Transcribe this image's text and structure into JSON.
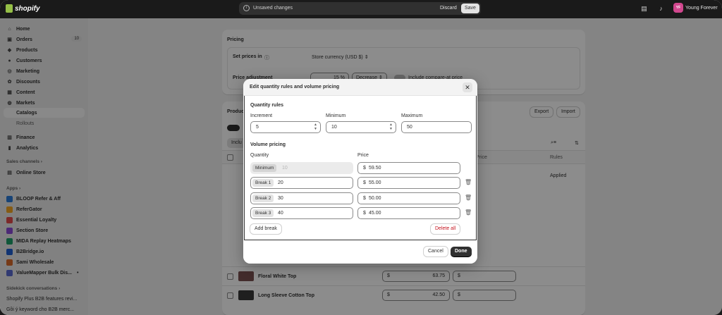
{
  "topbar": {
    "brand": "shopify",
    "unsaved_text": "Unsaved changes",
    "discard_label": "Discard",
    "save_label": "Save",
    "avatar_initials": "YF",
    "username": "Young Forever"
  },
  "sidebar": {
    "items": [
      {
        "label": "Home",
        "icon": "home-icon"
      },
      {
        "label": "Orders",
        "icon": "orders-icon",
        "badge": "10"
      },
      {
        "label": "Products",
        "icon": "tag-icon"
      },
      {
        "label": "Customers",
        "icon": "person-icon"
      },
      {
        "label": "Marketing",
        "icon": "target-icon"
      },
      {
        "label": "Discounts",
        "icon": "discount-icon"
      },
      {
        "label": "Content",
        "icon": "content-icon"
      },
      {
        "label": "Markets",
        "icon": "globe-icon"
      }
    ],
    "sub_items": [
      "Catalogs",
      "Rollouts"
    ],
    "items2": [
      {
        "label": "Finance",
        "icon": "bank-icon"
      },
      {
        "label": "Analytics",
        "icon": "chart-icon"
      }
    ],
    "sales_channels_heading": "Sales channels",
    "online_store": "Online Store",
    "apps_heading": "Apps",
    "apps": [
      {
        "label": "BLOOP Refer & Aff",
        "color": "#2b7bd8"
      },
      {
        "label": "ReferGator",
        "color": "#f5a623"
      },
      {
        "label": "Essential Loyalty",
        "color": "#e24c4c"
      },
      {
        "label": "Section Store",
        "color": "#8a4bd8"
      },
      {
        "label": "MIDA Replay Heatmaps",
        "color": "#1e9e6a"
      },
      {
        "label": "B2Bridge.io",
        "color": "#1f5fd1"
      },
      {
        "label": "Sami Wholesale",
        "color": "#d86a2b"
      },
      {
        "label": "ValueMapper Bulk Dis...",
        "color": "#5a6acf"
      }
    ],
    "sidekick_heading": "Sidekick conversations",
    "sidekick": [
      "Shopify Plus B2B features revi...",
      "Gồi ý keyword cho B2B merc..."
    ]
  },
  "pricing": {
    "heading": "Pricing",
    "set_prices_label": "Set prices in",
    "currency": "Store currency (USD $)",
    "price_adjustment_label": "Price adjustment",
    "adjust_value": "15",
    "adjust_unit": "%",
    "adjust_direction": "Decrease",
    "compare_label": "Include compare-at price"
  },
  "products": {
    "heading": "Produc",
    "export_label": "Export",
    "import_label": "Import",
    "filter_label": "Inclu",
    "col_price": "Price",
    "col_rules": "Rules",
    "rules_value": "Applied",
    "rows": [
      {
        "name": "Floral White Top",
        "price": "63.75"
      },
      {
        "name": "Long Sleeve Cotton Top",
        "price": "42.50"
      }
    ],
    "currency_symbol": "$"
  },
  "modal": {
    "title": "Edit quantity rules and volume pricing",
    "quantity_rules_heading": "Quantity rules",
    "increment_label": "Increment",
    "increment_value": "5",
    "minimum_label": "Minimum",
    "minimum_value": "10",
    "maximum_label": "Maximum",
    "maximum_value": "50",
    "volume_pricing_heading": "Volume pricing",
    "quantity_col": "Quantity",
    "price_col": "Price",
    "currency_symbol": "$",
    "minimum_row": {
      "tag": "Minimum",
      "qty": "10",
      "price": "59.50"
    },
    "breaks": [
      {
        "tag": "Break 1",
        "qty": "20",
        "price": "55.00"
      },
      {
        "tag": "Break 2",
        "qty": "30",
        "price": "50.00"
      },
      {
        "tag": "Break 3",
        "qty": "40",
        "price": "45.00"
      }
    ],
    "add_break_label": "Add break",
    "delete_all_label": "Delete all",
    "cancel_label": "Cancel",
    "done_label": "Done"
  }
}
